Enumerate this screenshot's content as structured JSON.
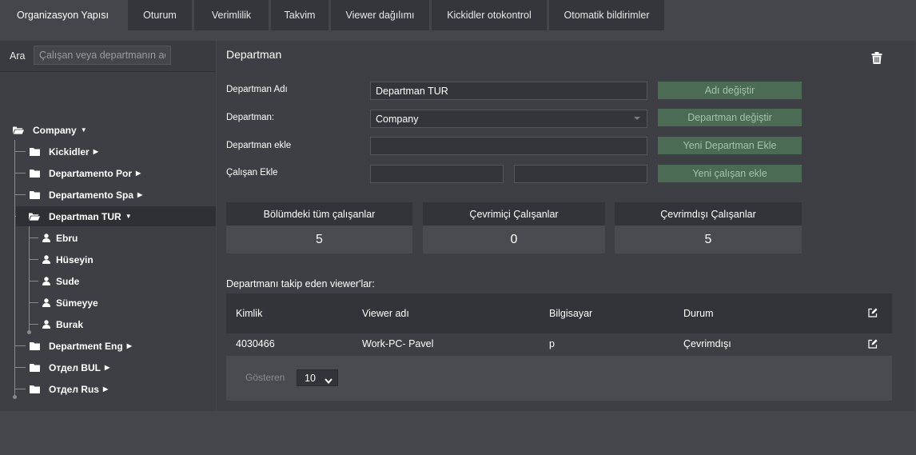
{
  "tabs": [
    {
      "label": "Organizasyon Yapısı",
      "active": true
    },
    {
      "label": "Oturum"
    },
    {
      "label": "Verimlilik"
    },
    {
      "label": "Takvim"
    },
    {
      "label": "Viewer dağılımı"
    },
    {
      "label": "Kickidler otokontrol"
    },
    {
      "label": "Otomatik bildirimler"
    }
  ],
  "search": {
    "label": "Ara",
    "placeholder": "Çalışan veya departmanın ad"
  },
  "tree": {
    "root": {
      "label": "Company",
      "icon": "folder-open-icon"
    },
    "items": [
      {
        "label": "Kickidler",
        "icon": "folder-icon"
      },
      {
        "label": "Departamento Por",
        "icon": "folder-icon"
      },
      {
        "label": "Departamento Spa",
        "icon": "folder-icon"
      },
      {
        "label": "Departman TUR",
        "icon": "folder-open-icon",
        "selected": true
      },
      {
        "label": "Ebru",
        "icon": "user-icon"
      },
      {
        "label": "Hüseyin",
        "icon": "user-icon"
      },
      {
        "label": "Sude",
        "icon": "user-icon"
      },
      {
        "label": "Sümeyye",
        "icon": "user-icon"
      },
      {
        "label": "Burak",
        "icon": "user-icon"
      },
      {
        "label": "Department Eng",
        "icon": "folder-icon"
      },
      {
        "label": "Отдел BUL",
        "icon": "folder-icon"
      },
      {
        "label": "Отдел Rus",
        "icon": "folder-icon"
      }
    ]
  },
  "department": {
    "title": "Departman",
    "delete_icon": "trash-icon",
    "name_label": "Departman Adı",
    "name_value": "Departman TUR",
    "rename_button": "Adı değiştir",
    "parent_label": "Departman:",
    "parent_value": "Company",
    "change_parent_button": "Departman değiştir",
    "add_dept_label": "Departman ekle",
    "add_dept_button": "Yeni Departman Ekle",
    "add_employee_label": "Çalışan Ekle",
    "add_employee_button": "Yeni çalışan ekle",
    "button_color": "#4c6b55"
  },
  "stats": [
    {
      "label": "Bölümdeki tüm çalışanlar",
      "value": "5"
    },
    {
      "label": "Çevrimiçi Çalışanlar",
      "value": "0"
    },
    {
      "label": "Çevrimdışı Çalışanlar",
      "value": "5"
    }
  ],
  "viewers": {
    "title": "Departmanı takip eden viewer'lar:",
    "columns": [
      "Kimlik",
      "Viewer adı",
      "Bilgisayar",
      "Durum"
    ],
    "rows": [
      {
        "id": "4030466",
        "name": "Work-PC- Pavel",
        "computer": "p",
        "status": "Çevrimdışı"
      }
    ],
    "pager_label": "Gösteren",
    "pager_value": "10"
  }
}
